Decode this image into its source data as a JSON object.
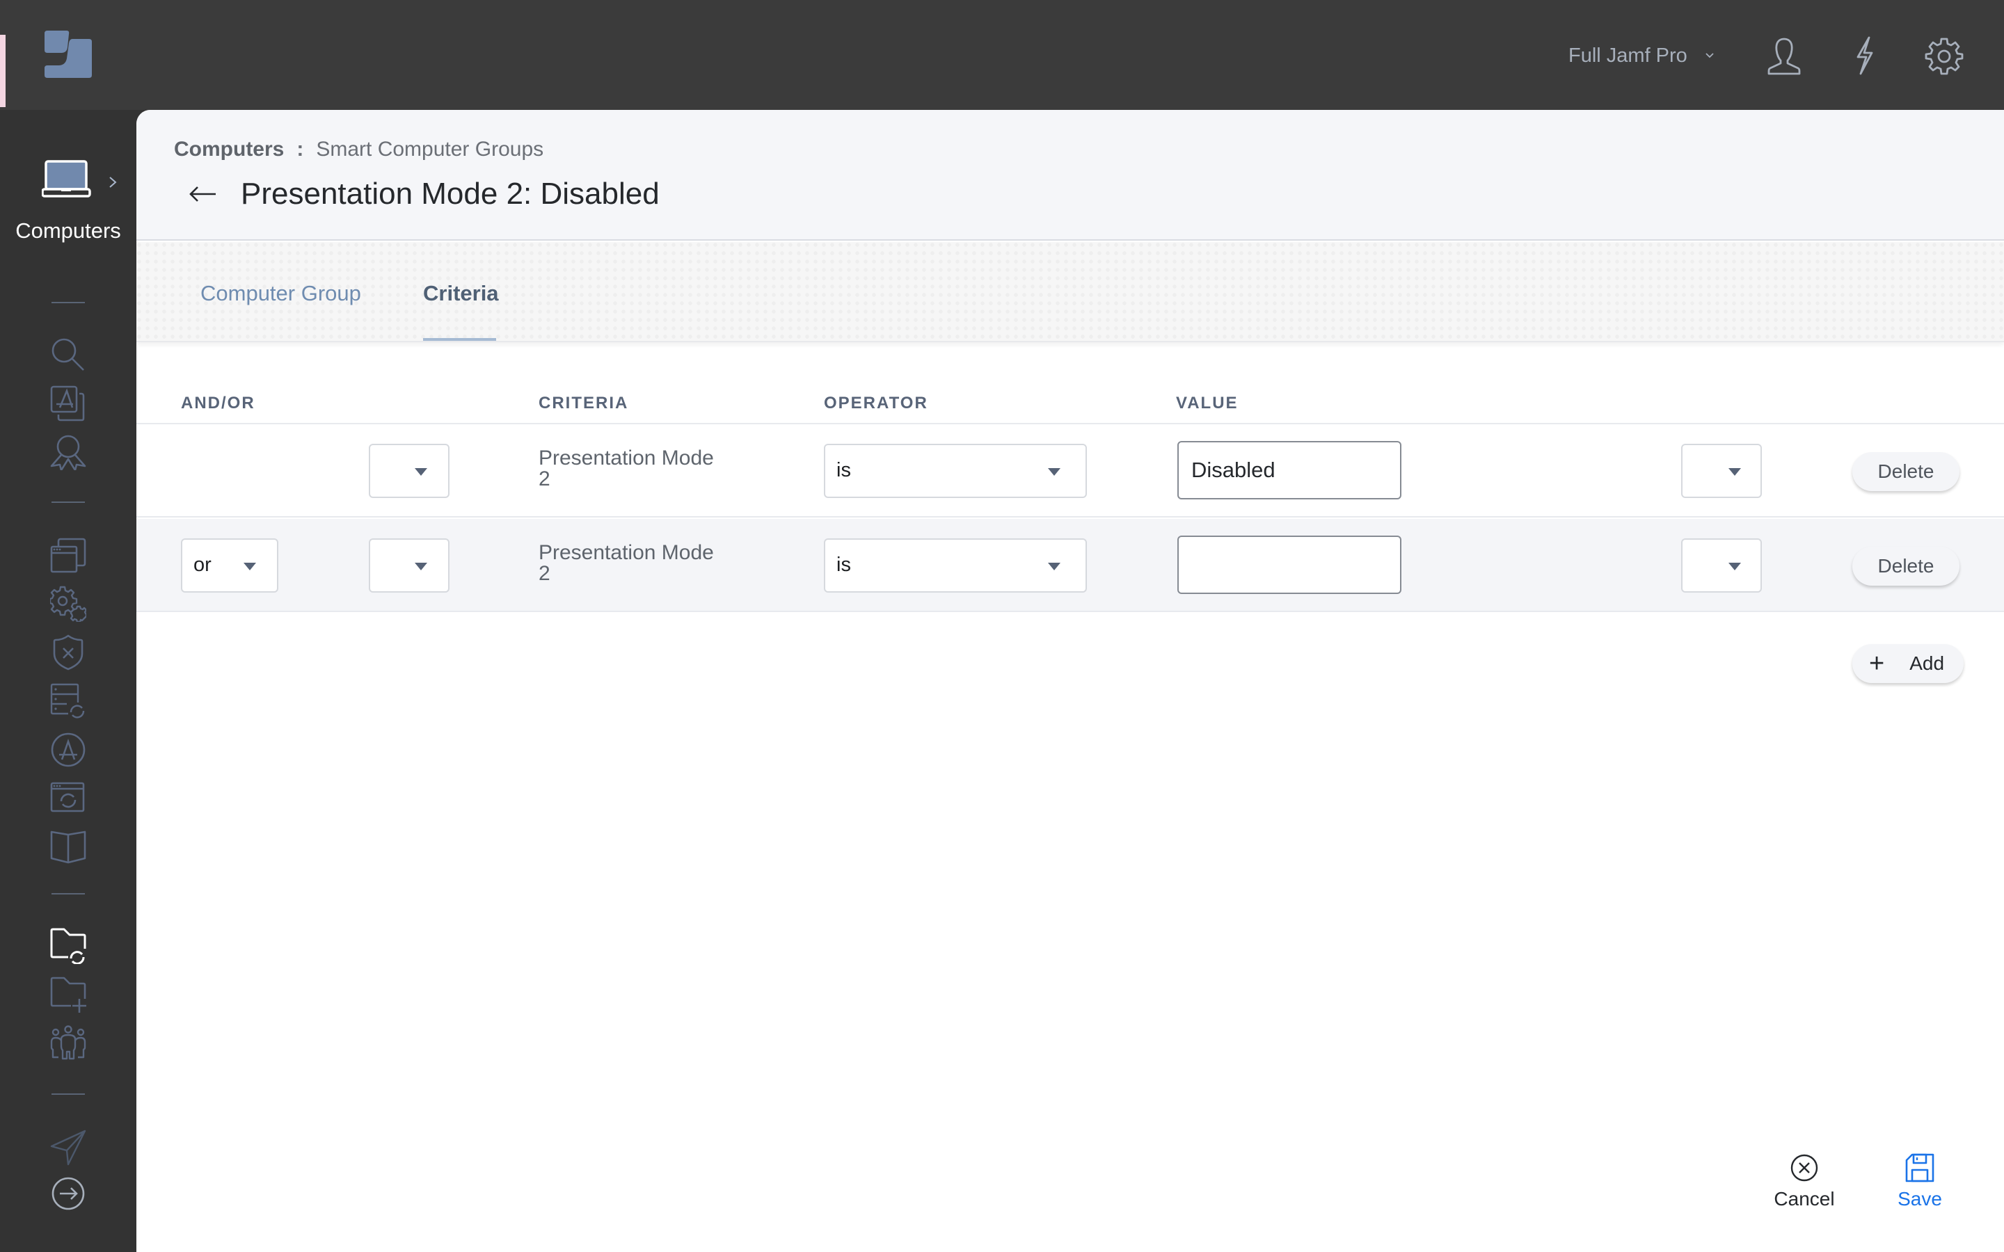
{
  "topbar": {
    "environment_label": "Full Jamf Pro",
    "icons": [
      "jamf-logo-icon",
      "user-icon",
      "lightning-icon",
      "gear-icon"
    ]
  },
  "sidebar": {
    "section_label": "Computers",
    "items": [
      {
        "icon": "search-icon",
        "active": false
      },
      {
        "icon": "app-catalog-icon",
        "active": false
      },
      {
        "icon": "award-ribbon-icon",
        "active": false
      },
      {
        "icon": "windows-stack-icon",
        "active": false
      },
      {
        "icon": "gears-icon",
        "active": false
      },
      {
        "icon": "shield-x-icon",
        "active": false
      },
      {
        "icon": "server-sync-icon",
        "active": false
      },
      {
        "icon": "app-store-icon",
        "active": false
      },
      {
        "icon": "window-sync-icon",
        "active": false
      },
      {
        "icon": "book-icon",
        "active": false
      },
      {
        "icon": "smart-folder-sync-icon",
        "active": true
      },
      {
        "icon": "folder-plus-icon",
        "active": false
      },
      {
        "icon": "users-group-icon",
        "active": false
      },
      {
        "icon": "paper-plane-icon",
        "active": false
      },
      {
        "icon": "arrow-circle-right-icon",
        "active": false
      }
    ]
  },
  "header": {
    "breadcrumb_root": "Computers",
    "breadcrumb_separator": ":",
    "breadcrumb_current": "Smart Computer Groups",
    "title": "Presentation Mode 2: Disabled"
  },
  "tabs": [
    {
      "label": "Computer Group",
      "active": false
    },
    {
      "label": "Criteria",
      "active": true
    }
  ],
  "criteria_table": {
    "columns": [
      "AND/OR",
      "CRITERIA",
      "OPERATOR",
      "VALUE"
    ],
    "rows": [
      {
        "and_or": "",
        "open_paren": "",
        "criteria_line1": "Presentation Mode",
        "criteria_line2": "2",
        "operator": "is",
        "value": "Disabled",
        "close_paren": "",
        "delete_label": "Delete"
      },
      {
        "and_or": "or",
        "open_paren": "",
        "criteria_line1": "Presentation Mode",
        "criteria_line2": "2",
        "operator": "is",
        "value": "",
        "close_paren": "",
        "delete_label": "Delete"
      }
    ],
    "add_label": "Add"
  },
  "footer": {
    "cancel_label": "Cancel",
    "save_label": "Save"
  },
  "colors": {
    "topbar_bg": "#3b3b3b",
    "sidebar_bg": "#333333",
    "icon_muted": "#5a6780",
    "accent_blue": "#1a73e8",
    "tab_active": "#4f6075",
    "tab_inactive": "#6f8cb0"
  }
}
